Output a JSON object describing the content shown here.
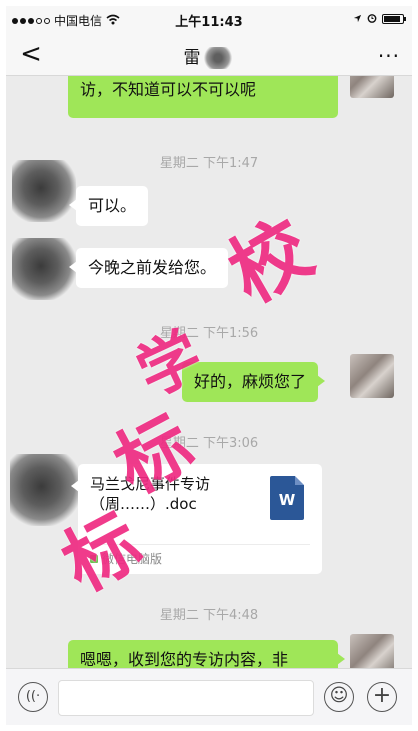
{
  "status_bar": {
    "carrier": "中国电信",
    "time": "上午11:43"
  },
  "nav": {
    "back_label": "<",
    "title": "雷",
    "more_label": "···"
  },
  "messages": [
    {
      "side": "me",
      "text_line1": "…………………………………………",
      "text_line2": "访，不知道可以不可以呢"
    },
    {
      "type": "time",
      "text": "星期二 下午1:47"
    },
    {
      "side": "other",
      "text": "可以。"
    },
    {
      "side": "other",
      "text": "今晚之前发给您。"
    },
    {
      "type": "time",
      "text": "星期二 下午1:56"
    },
    {
      "side": "me",
      "text": "好的，麻烦您了"
    },
    {
      "type": "time",
      "text": "星期二 下午3:06"
    },
    {
      "side": "other",
      "type": "file",
      "file_line1": "马兰戈尼事件专访",
      "file_line2": "（周……）.doc",
      "icon_letter": "W",
      "source": "微信电脑版"
    },
    {
      "type": "time",
      "text": "星期二 下午4:48"
    },
    {
      "side": "me",
      "text": "嗯嗯，收到您的专访内容，非"
    }
  ],
  "watermark": {
    "text": "学校标标",
    "color": "#ef2b82"
  },
  "input_bar": {
    "voice_icon": "((·",
    "emoji_icon": "☺",
    "plus_icon": "+"
  },
  "colors": {
    "green_bubble": "#9fe658",
    "chat_bg": "#ebebeb"
  }
}
